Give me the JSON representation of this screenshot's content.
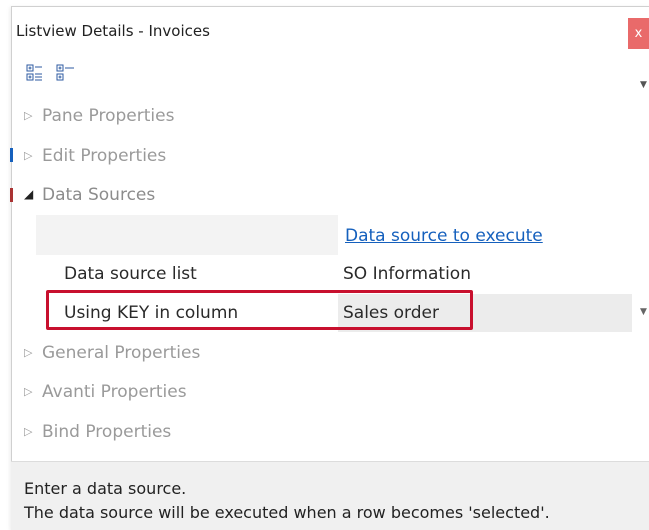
{
  "window": {
    "title": "Listview Details - Invoices",
    "close_glyph": "x"
  },
  "toolbar": {
    "icons": [
      "expand-all-icon",
      "collapse-all-icon"
    ],
    "dropdown_glyph": "▼"
  },
  "sections": {
    "pane": {
      "label": "Pane Properties",
      "arrow": "▷"
    },
    "edit": {
      "label": "Edit Properties",
      "arrow": "▷"
    },
    "data_sources": {
      "label": "Data Sources",
      "arrow": "◢"
    },
    "general": {
      "label": "General Properties",
      "arrow": "▷"
    },
    "avanti": {
      "label": "Avanti Properties",
      "arrow": "▷"
    },
    "bind": {
      "label": "Bind Properties",
      "arrow": "▷"
    }
  },
  "data_sources": {
    "link": "Data source to execute",
    "list_label": "Data source list",
    "list_value": "SO Information",
    "key_label": "Using KEY in column",
    "key_value": "Sales order",
    "dropdown_glyph": "▼"
  },
  "description": {
    "line1": "Enter a data source.",
    "line2": "The data source will be executed when a row  becomes 'selected'."
  },
  "colors": {
    "highlight": "#c8102e",
    "link": "#1560bd",
    "close": "#e96a6a"
  }
}
